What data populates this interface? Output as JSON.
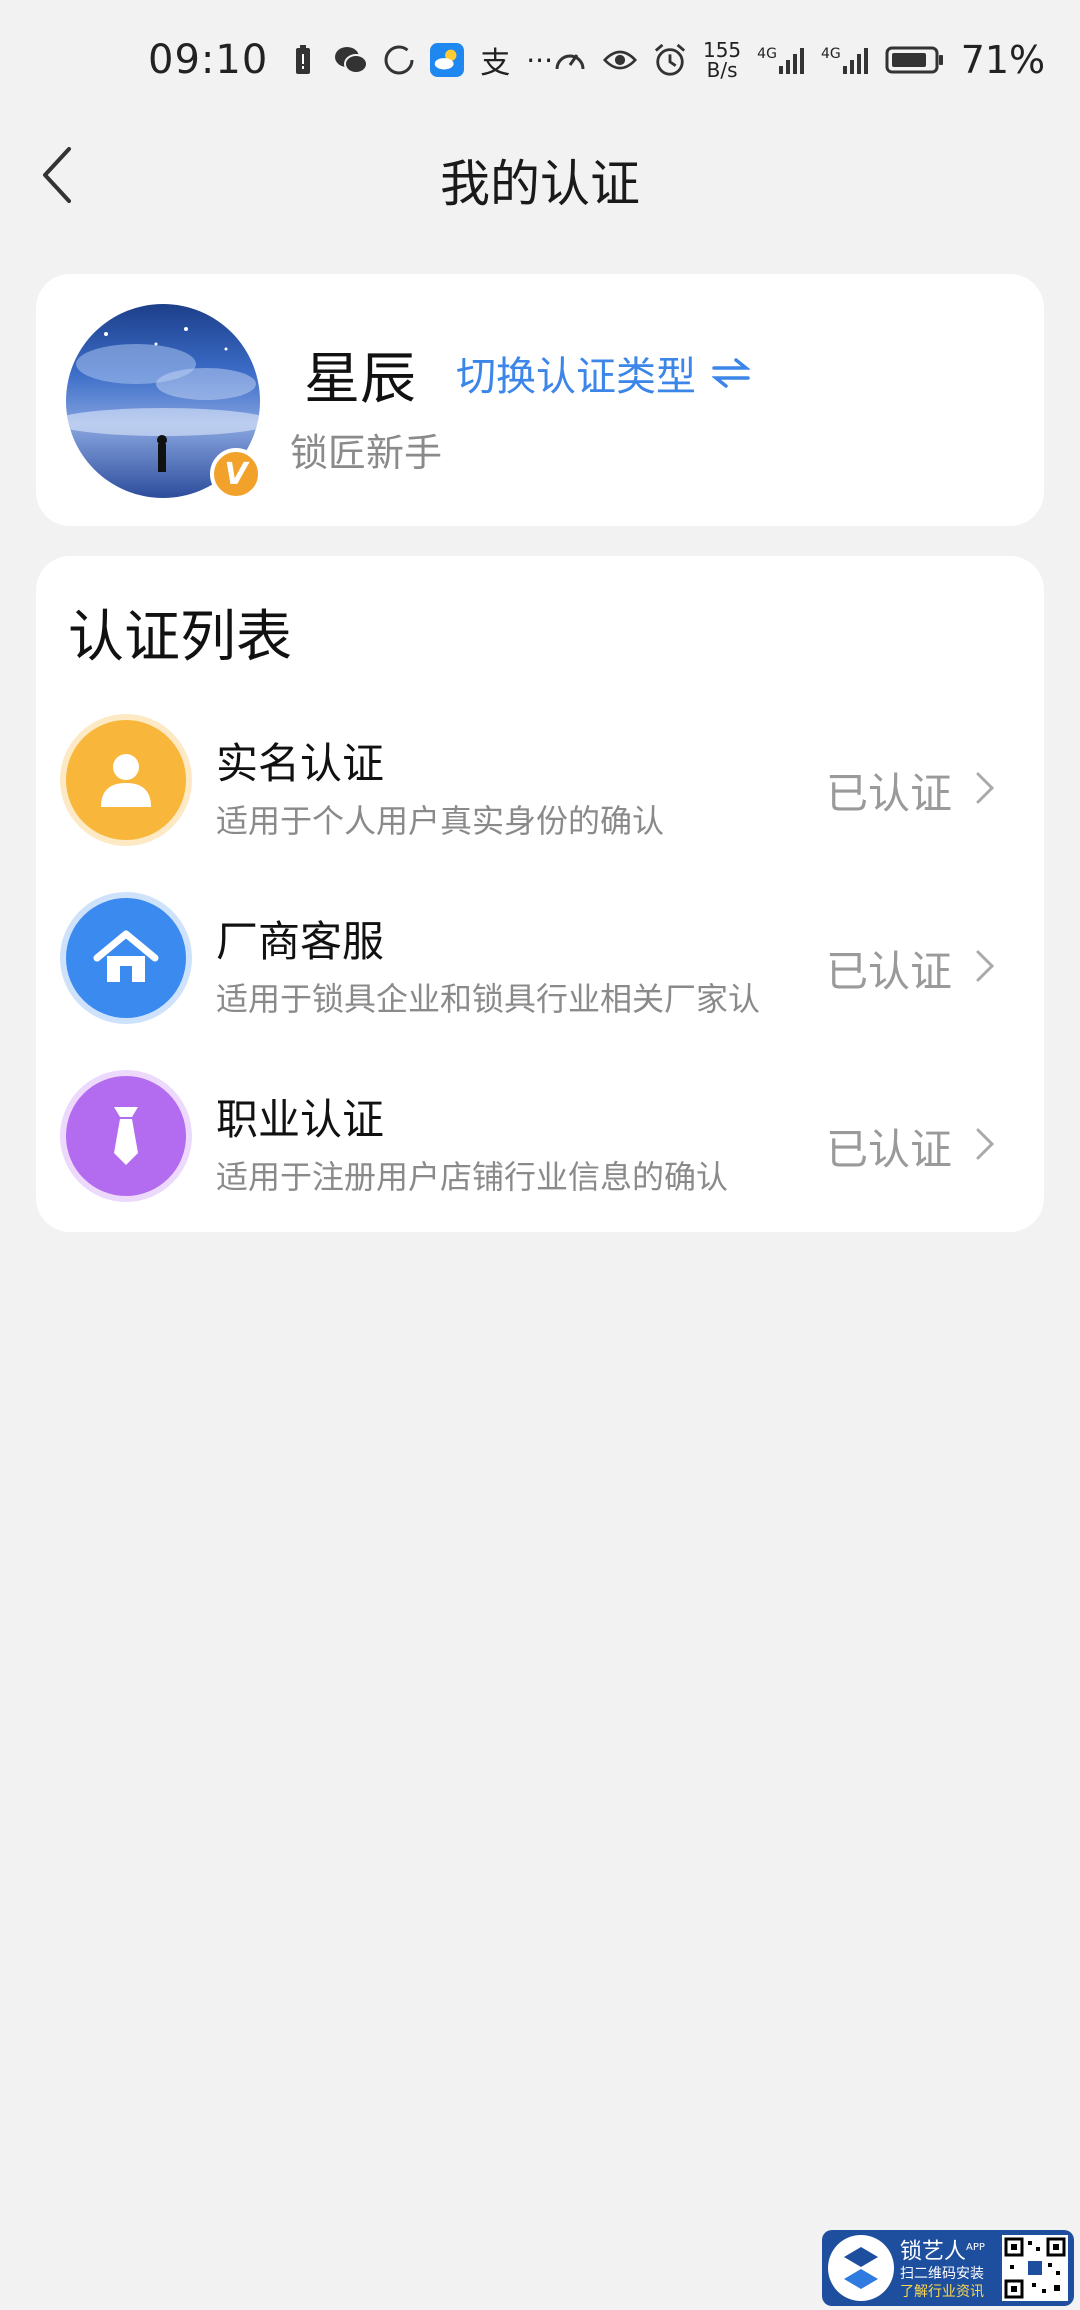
{
  "status_bar": {
    "time": "09:10",
    "net_speed_value": "155",
    "net_speed_unit": "B/s",
    "signal_1": "4G",
    "signal_2": "4G",
    "battery": "71%",
    "more": "···",
    "alipay_glyph": "支"
  },
  "header": {
    "title": "我的认证",
    "back_icon": "chevron-left-icon"
  },
  "profile": {
    "name": "星辰",
    "switch_label": "切换认证类型",
    "role": "锁匠新手",
    "badge_letter": "V",
    "badge_color": "#f2a12b"
  },
  "cert_list": {
    "title": "认证列表",
    "items": [
      {
        "name": "实名认证",
        "desc": "适用于个人用户真实身份的确认",
        "status": "已认证",
        "icon": "person-icon",
        "color": "#f8b73b"
      },
      {
        "name": "厂商客服",
        "desc": " 适用于锁具企业和锁具行业相关厂家认",
        "status": "已认证",
        "icon": "house-icon",
        "color": "#3b8af0"
      },
      {
        "name": "职业认证",
        "desc": "适用于注册用户店铺行业信息的确认",
        "status": "已认证",
        "icon": "tie-icon",
        "color": "#b36cf0"
      }
    ]
  },
  "watermark": {
    "brand": "锁艺人",
    "sup": "APP",
    "line1": "扫二维码安装",
    "line2": "了解行业资讯"
  },
  "colors": {
    "accent": "#3b86e8",
    "background": "#f2f2f2"
  }
}
